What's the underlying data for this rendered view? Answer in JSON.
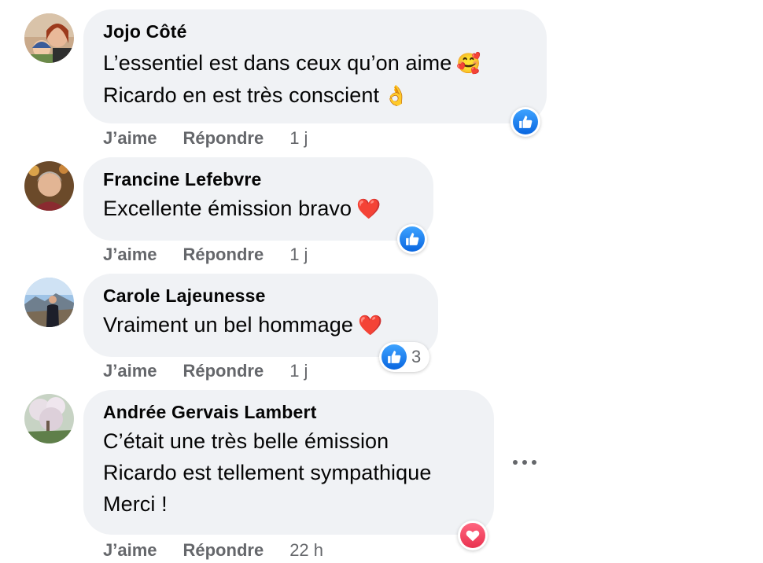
{
  "comments": [
    {
      "author": "Jojo Côté",
      "lines": [
        "L’essentiel est dans ceux qu’on aime",
        "Ricardo en est très conscient"
      ],
      "emojis": [
        "🥰",
        "👌"
      ],
      "like_label": "J’aime",
      "reply_label": "Répondre",
      "time": "1 j",
      "reaction": "like-icon"
    },
    {
      "author": "Francine Lefebvre",
      "lines": [
        "Excellente émission bravo"
      ],
      "emojis": [
        "❤️"
      ],
      "like_label": "J’aime",
      "reply_label": "Répondre",
      "time": "1 j",
      "reaction": "like-icon"
    },
    {
      "author": "Carole Lajeunesse",
      "lines": [
        "Vraiment un bel hommage"
      ],
      "emojis": [
        "❤️"
      ],
      "like_label": "J’aime",
      "reply_label": "Répondre",
      "time": "1 j",
      "reaction": "like-icon",
      "reaction_count": "3"
    },
    {
      "author": "Andrée Gervais Lambert",
      "lines": [
        "C’était une très belle émission",
        "Ricardo est tellement sympathique",
        "Merci !"
      ],
      "like_label": "J’aime",
      "reply_label": "Répondre",
      "time": "22 h",
      "reaction": "heart-icon"
    }
  ],
  "colors": {
    "bubble": "#f0f2f5",
    "meta_text": "#65676b",
    "like_blue": "#1877f2",
    "love_red": "#f33e58"
  }
}
